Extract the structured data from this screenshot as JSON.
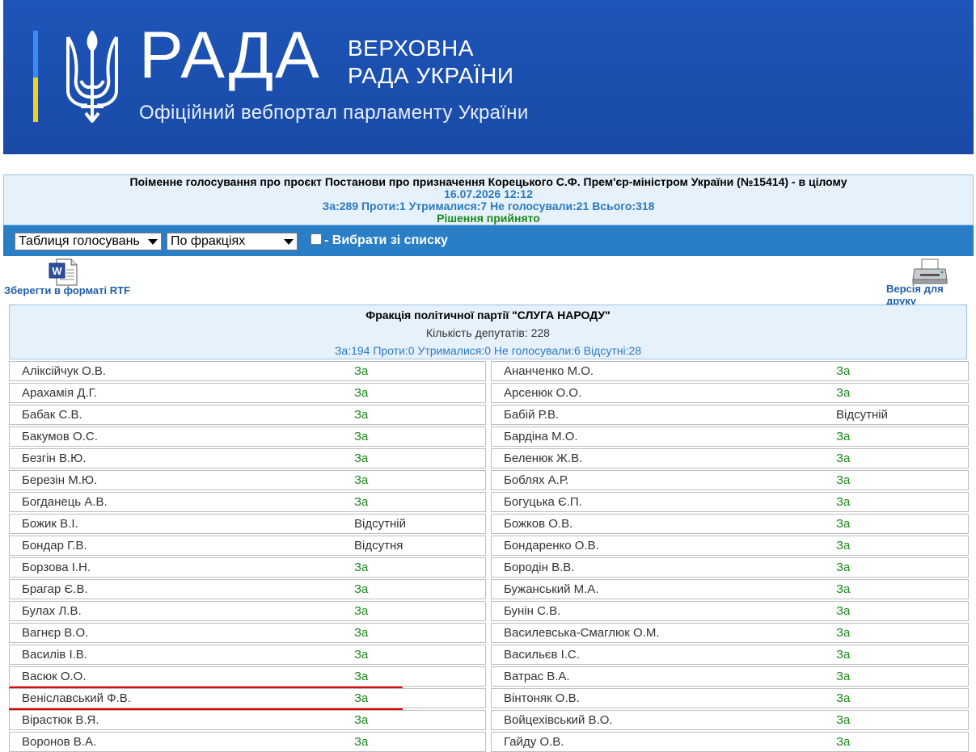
{
  "header": {
    "logo_text": "РАДА",
    "sub_line1": "ВЕРХОВНА",
    "sub_line2": "РАДА УКРАЇНИ",
    "tagline": "Офіційний вебпортал парламенту України"
  },
  "vote": {
    "title": "Поіменне голосування про проєкт Постанови про призначення Корецького С.Ф. Прем'єр-міністром України (№15414) - в цілому",
    "date": "16.07.2026 12:12",
    "counts": "За:289 Проти:1 Утрималися:7 Не голосували:21 Всього:318",
    "decision": "Рішення прийнято"
  },
  "toolbar": {
    "select1": "Таблиця голосувань",
    "select2": "По фракціях",
    "checkbox_label": "- Вибрати зі списку"
  },
  "links": {
    "rtf": "Зберегти в форматі RTF",
    "print": "Версія для друку"
  },
  "faction": {
    "name": "Фракція політичної партії \"СЛУГА НАРОДУ\"",
    "count": "Кількість депутатів: 228",
    "stats": "За:194 Проти:0 Утрималися:0 Не голосували:6 Відсутні:28"
  },
  "colors": {
    "header_bg": "#1b4fb0",
    "toolbar_bg": "#2a7ec6",
    "vote_for": "#1a8a1a",
    "highlight": "#e00000"
  },
  "deputies_left": [
    {
      "name": "Аліксійчук О.В.",
      "vote": "За"
    },
    {
      "name": "Арахамія Д.Г.",
      "vote": "За"
    },
    {
      "name": "Бабак С.В.",
      "vote": "За"
    },
    {
      "name": "Бакумов О.С.",
      "vote": "За"
    },
    {
      "name": "Безгін В.Ю.",
      "vote": "За"
    },
    {
      "name": "Березін М.Ю.",
      "vote": "За"
    },
    {
      "name": "Богданець А.В.",
      "vote": "За"
    },
    {
      "name": "Божик В.І.",
      "vote": "Відсутній"
    },
    {
      "name": "Бондар Г.В.",
      "vote": "Відсутня"
    },
    {
      "name": "Борзова І.Н.",
      "vote": "За"
    },
    {
      "name": "Брагар Є.В.",
      "vote": "За"
    },
    {
      "name": "Булах Л.В.",
      "vote": "За"
    },
    {
      "name": "Вагнєр В.О.",
      "vote": "За"
    },
    {
      "name": "Василів І.В.",
      "vote": "За"
    },
    {
      "name": "Васюк О.О.",
      "vote": "За"
    },
    {
      "name": "Веніславський Ф.В.",
      "vote": "За"
    },
    {
      "name": "Вірастюк В.Я.",
      "vote": "За"
    },
    {
      "name": "Воронов В.А.",
      "vote": "За"
    }
  ],
  "deputies_right": [
    {
      "name": "Ананченко М.О.",
      "vote": "За"
    },
    {
      "name": "Арсенюк О.О.",
      "vote": "За"
    },
    {
      "name": "Бабій Р.В.",
      "vote": "Відсутній"
    },
    {
      "name": "Бардіна М.О.",
      "vote": "За"
    },
    {
      "name": "Беленюк Ж.В.",
      "vote": "За"
    },
    {
      "name": "Боблях А.Р.",
      "vote": "За"
    },
    {
      "name": "Богуцька Є.П.",
      "vote": "За"
    },
    {
      "name": "Божков О.В.",
      "vote": "За"
    },
    {
      "name": "Бондаренко О.В.",
      "vote": "За"
    },
    {
      "name": "Бородін В.В.",
      "vote": "За"
    },
    {
      "name": "Бужанський М.А.",
      "vote": "За"
    },
    {
      "name": "Бунін С.В.",
      "vote": "За"
    },
    {
      "name": "Василевська-Смаглюк О.М.",
      "vote": "За"
    },
    {
      "name": "Васильєв І.С.",
      "vote": "За"
    },
    {
      "name": "Ватрас В.А.",
      "vote": "За"
    },
    {
      "name": "Вінтоняк О.В.",
      "vote": "За"
    },
    {
      "name": "Войцехівський В.О.",
      "vote": "За"
    },
    {
      "name": "Гайду О.В.",
      "vote": "За"
    }
  ]
}
